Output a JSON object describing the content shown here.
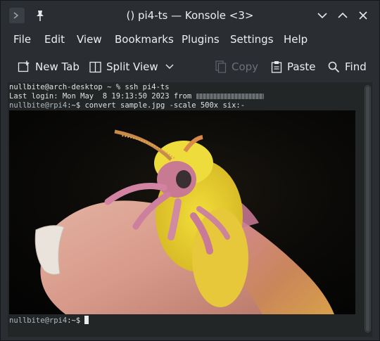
{
  "window": {
    "title": "() pi4-ts — Konsole <3>"
  },
  "menu": [
    "File",
    "Edit",
    "View",
    "Bookmarks",
    "Plugins",
    "Settings",
    "Help"
  ],
  "toolbar": {
    "new_tab": "New Tab",
    "split_view": "Split View",
    "copy": "Copy",
    "paste": "Paste",
    "find": "Find"
  },
  "terminal": {
    "line1": "nullbite@arch-desktop ~ % ssh pi4-ts",
    "line2_prefix": "Last login: Mon May  8 19:13:50 2023 from ",
    "line3_user": "nullbite@rpi4",
    "line3_rest": ":~$ convert sample.jpg -scale 500x six:-",
    "line4_user": "nullbite@rpi4",
    "line4_rest": ":~$ "
  },
  "icons": {
    "app": "konsole-icon",
    "pin": "pin-icon",
    "minimize": "chevron-down-icon",
    "maximize": "chevron-up-icon",
    "close": "close-icon",
    "new_tab": "new-tab-icon",
    "split_view": "split-view-icon",
    "copy": "copy-icon",
    "paste": "paste-icon",
    "find": "search-icon"
  },
  "image": {
    "subject": "moth-on-fingertip-photo"
  }
}
